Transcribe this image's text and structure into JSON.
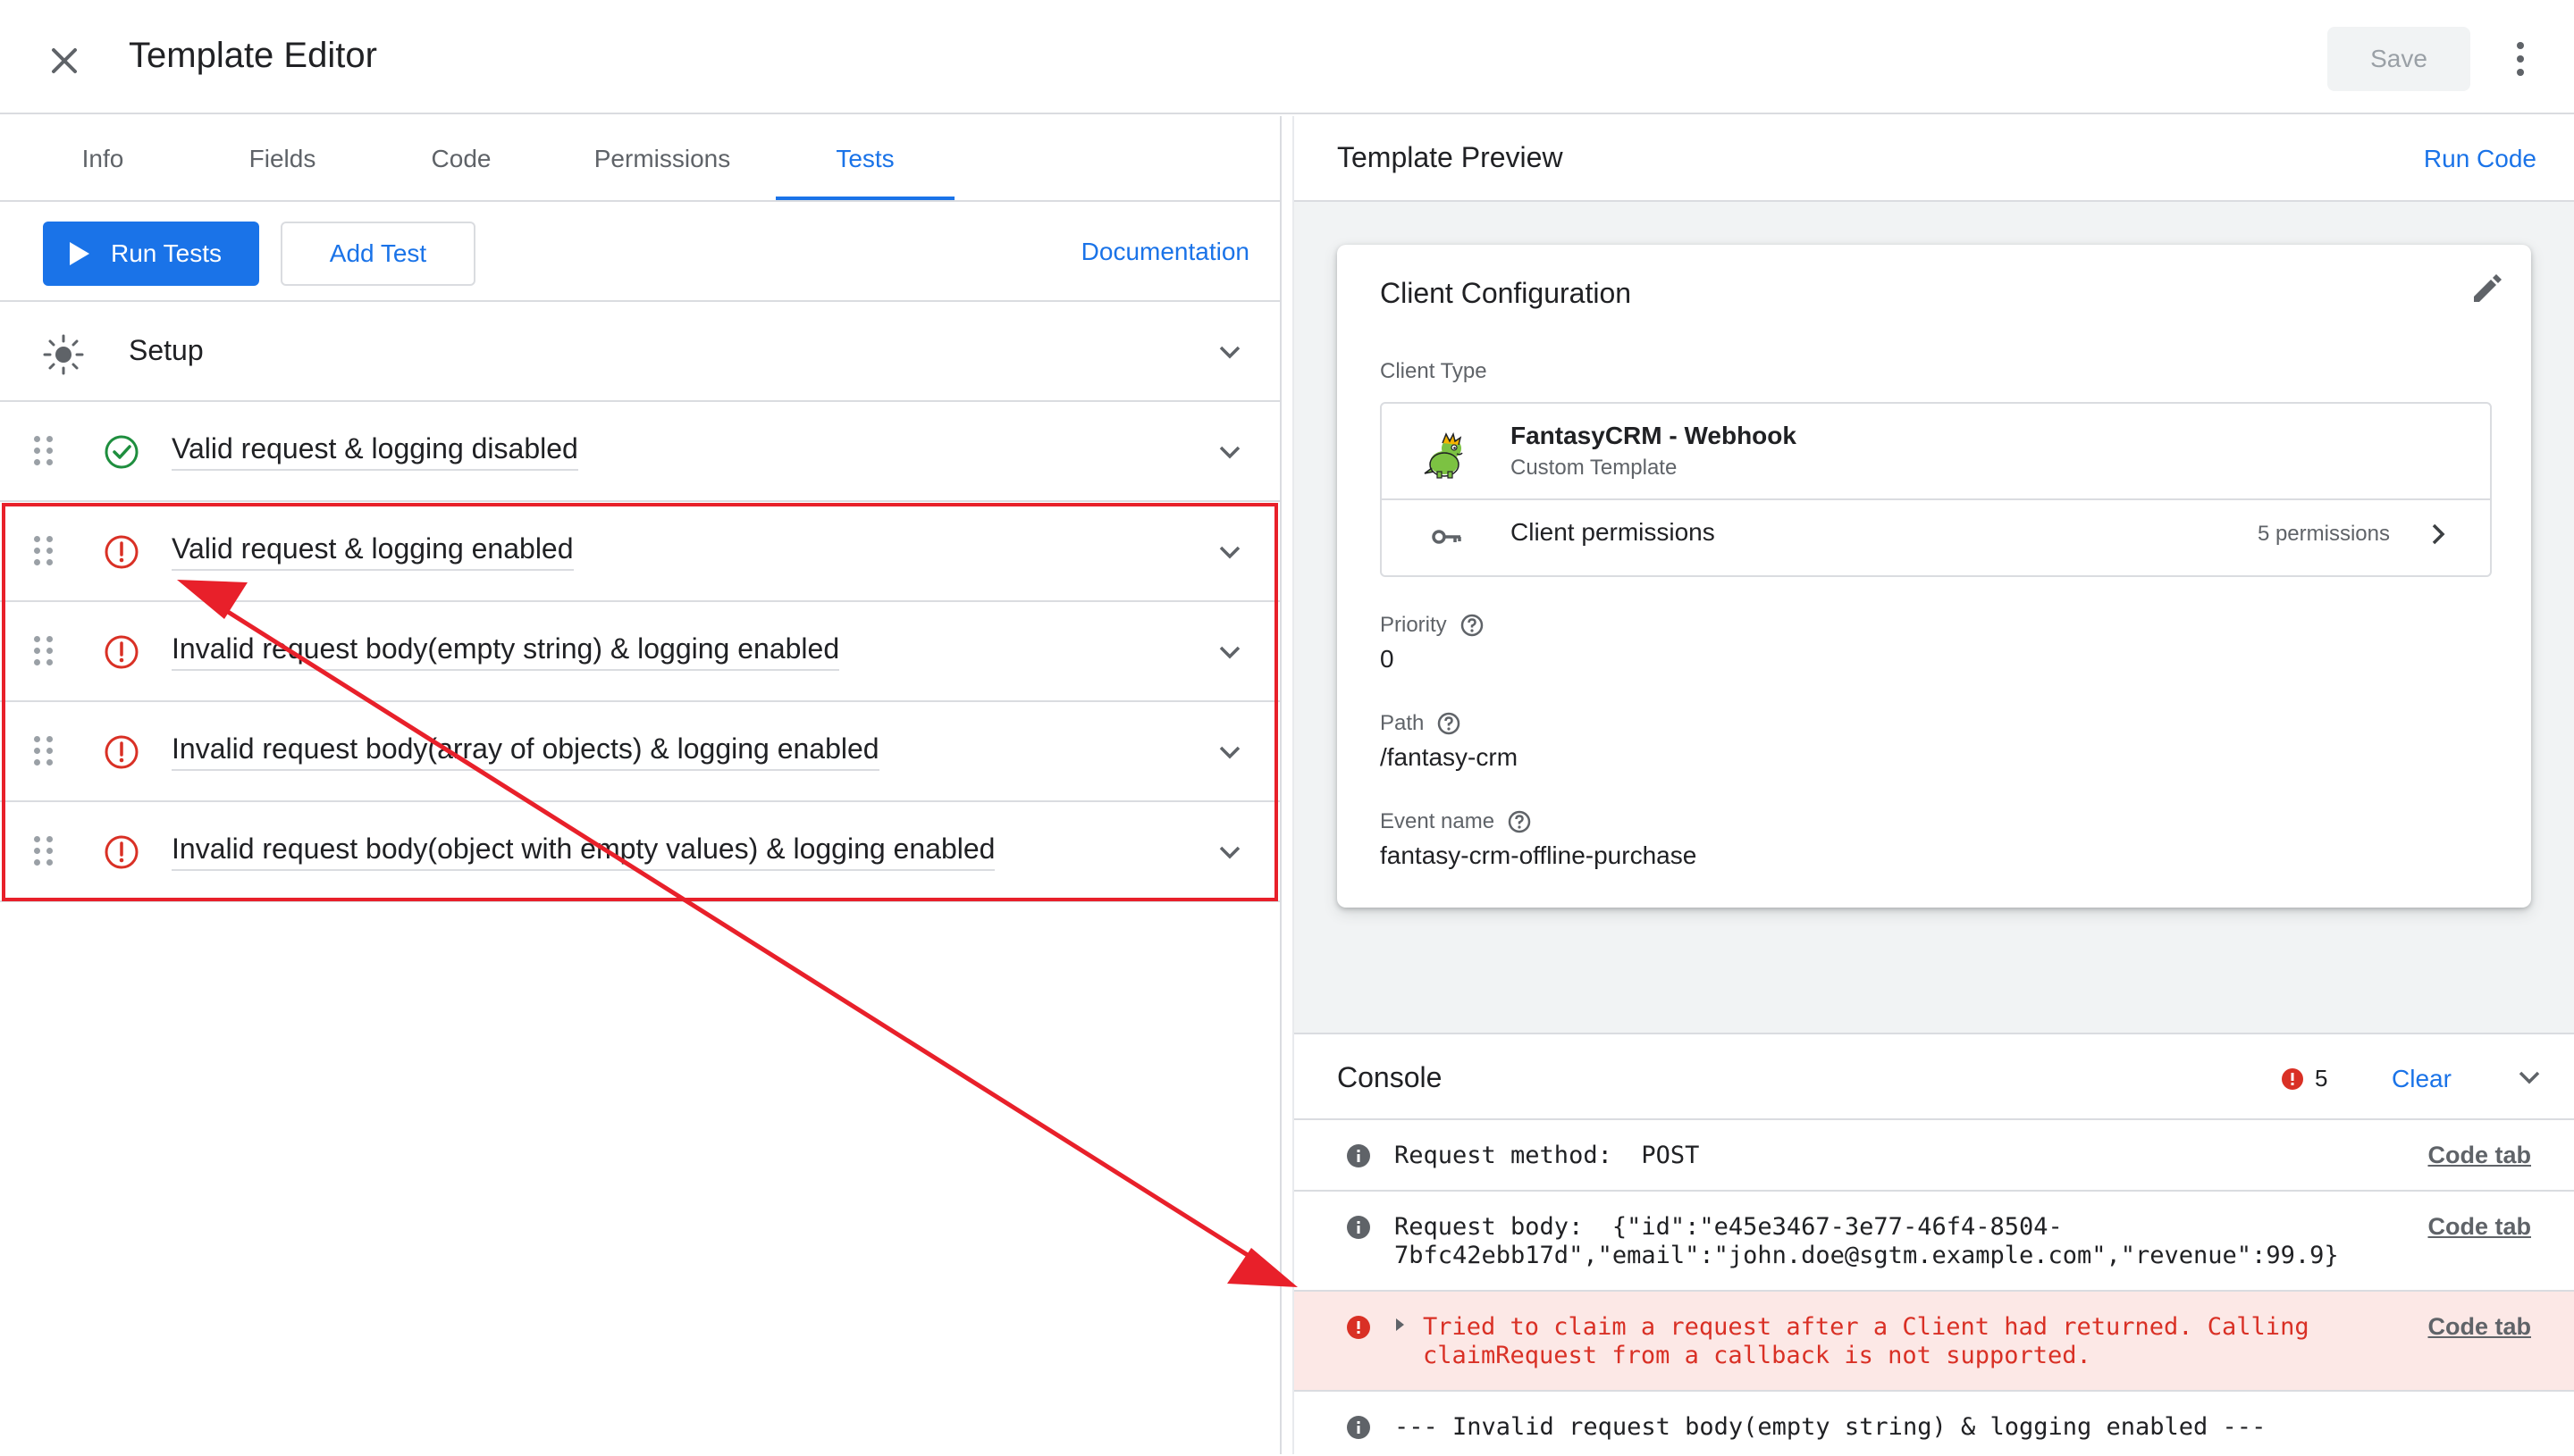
{
  "header": {
    "title": "Template Editor",
    "save_label": "Save"
  },
  "tabs": [
    {
      "label": "Info"
    },
    {
      "label": "Fields"
    },
    {
      "label": "Code"
    },
    {
      "label": "Permissions"
    },
    {
      "label": "Tests",
      "active": true
    }
  ],
  "toolbar": {
    "run_tests_label": "Run Tests",
    "add_test_label": "Add Test",
    "documentation_label": "Documentation"
  },
  "tests": {
    "setup_label": "Setup",
    "items": [
      {
        "label": "Valid request & logging disabled",
        "status": "passed"
      },
      {
        "label": "Valid request & logging enabled",
        "status": "failed"
      },
      {
        "label": "Invalid request body(empty string) & logging enabled",
        "status": "failed"
      },
      {
        "label": "Invalid request body(array of objects) & logging enabled",
        "status": "failed"
      },
      {
        "label": "Invalid request body(object with empty values) & logging enabled",
        "status": "failed"
      }
    ]
  },
  "preview": {
    "title": "Template Preview",
    "run_code_label": "Run Code",
    "card": {
      "title": "Client Configuration",
      "client_type_label": "Client Type",
      "client_name": "FantasyCRM - Webhook",
      "client_sub": "Custom Template",
      "permissions_label": "Client permissions",
      "permissions_count": "5 permissions",
      "priority_label": "Priority",
      "priority_value": "0",
      "path_label": "Path",
      "path_value": "/fantasy-crm",
      "event_label": "Event name",
      "event_value": "fantasy-crm-offline-purchase"
    }
  },
  "console": {
    "title": "Console",
    "error_count": "5",
    "clear_label": "Clear",
    "code_tab_label": "Code tab",
    "logs": [
      {
        "type": "info",
        "text": "Request method:  POST"
      },
      {
        "type": "info",
        "text": "Request body:  {\"id\":\"e45e3467-3e77-46f4-8504-\n7bfc42ebb17d\",\"email\":\"john.doe@sgtm.example.com\",\"revenue\":99.9}"
      },
      {
        "type": "error",
        "text": "Tried to claim a request after a Client had returned. Calling\nclaimRequest from a callback is not supported."
      },
      {
        "type": "info",
        "text": "--- Invalid request body(empty string) & logging enabled ---"
      }
    ]
  },
  "colors": {
    "accent": "#1a73e8",
    "error": "#d93025",
    "success": "#1e8e3e",
    "annotation": "#e8202a",
    "error_bg": "#fce8e6"
  },
  "icons": [
    "close-icon",
    "more-vert-icon",
    "play-icon",
    "sun-icon",
    "check-circle-icon",
    "error-circle-icon",
    "chevron-down-icon",
    "drag-handle-icon",
    "edit-pencil-icon",
    "dragon-icon",
    "key-icon",
    "chevron-right-icon",
    "help-icon",
    "info-icon",
    "error-icon"
  ]
}
